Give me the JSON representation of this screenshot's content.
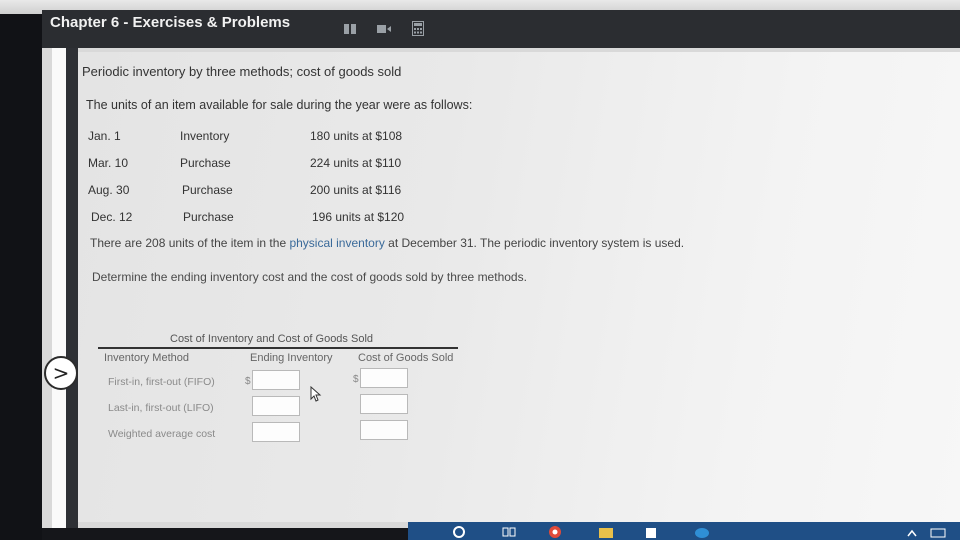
{
  "app": {
    "title": "Chapter 6 - Exercises & Problems",
    "header_icons": [
      "book-icon",
      "video-icon",
      "calculator-icon"
    ]
  },
  "problem": {
    "title": "Periodic inventory by three methods; cost of goods sold",
    "intro": "The units of an item available for sale during the year were as follows:",
    "rows": [
      {
        "date": "Jan. 1",
        "type": "Inventory",
        "units": "180 units at $108"
      },
      {
        "date": "Mar. 10",
        "type": "Purchase",
        "units": "224 units at $110"
      },
      {
        "date": "Aug. 30",
        "type": "Purchase",
        "units": "200 units at $116"
      },
      {
        "date": "Dec. 12",
        "type": "Purchase",
        "units": "196 units at $120"
      }
    ],
    "note_start": "There are 208 units of the item in the ",
    "note_link": "physical inventory",
    "note_end": " at December 31. The periodic inventory system is used.",
    "task": "Determine the ending inventory cost and the cost of goods sold by three methods."
  },
  "table": {
    "caption": "Cost of Inventory and Cost of Goods Sold",
    "headers": {
      "method": "Inventory Method",
      "ending": "Ending Inventory",
      "cogs": "Cost of Goods Sold"
    },
    "currency": "$",
    "rows": [
      {
        "label": "First-in, first-out (FIFO)",
        "ending_value": "",
        "cogs_value": ""
      },
      {
        "label": "Last-in, first-out (LIFO)",
        "ending_value": "",
        "cogs_value": ""
      },
      {
        "label": "Weighted average cost",
        "ending_value": "",
        "cogs_value": ""
      }
    ]
  },
  "nav": {
    "next_symbol": ">"
  },
  "colors": {
    "header_bg": "#2b2d31",
    "link_blue": "#3a6a9a",
    "taskbar_blue": "#1f4f86"
  }
}
